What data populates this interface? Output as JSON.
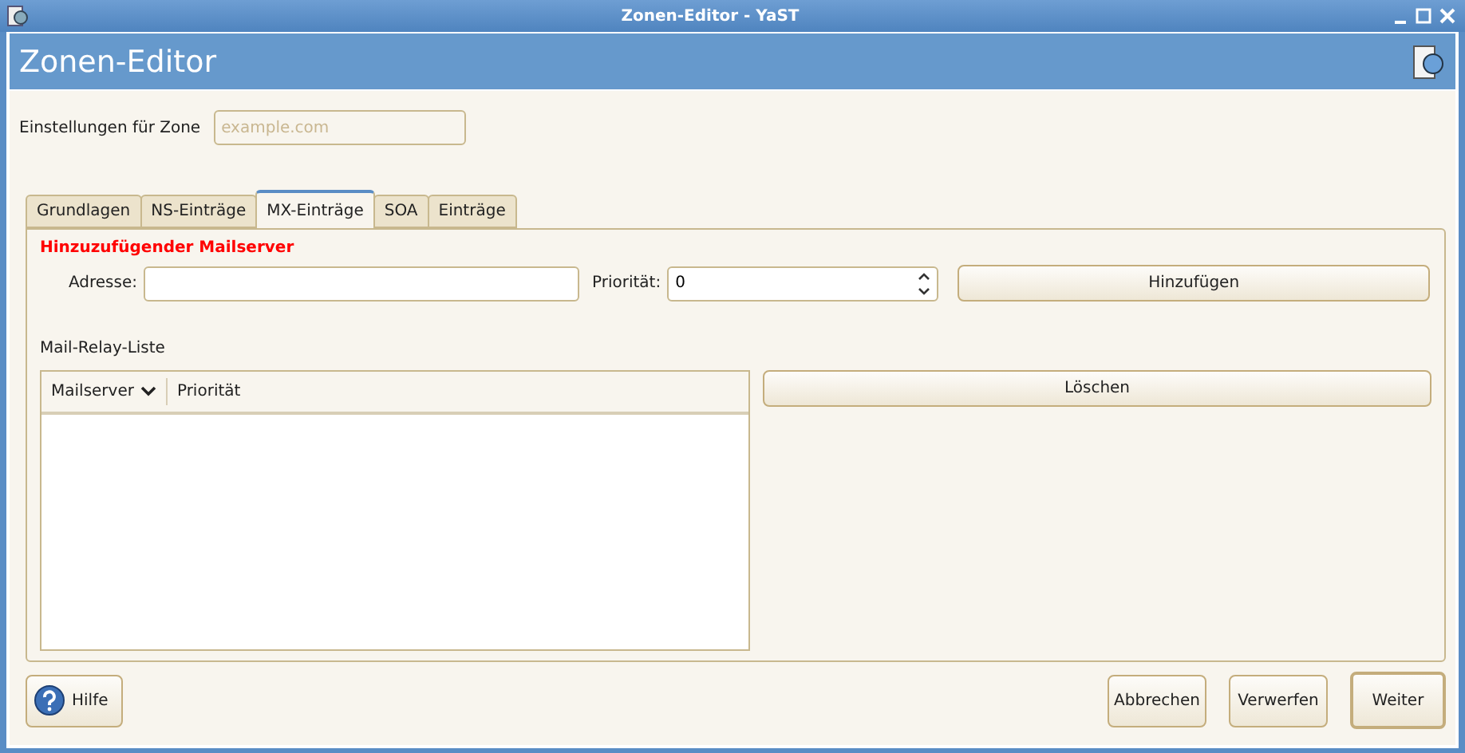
{
  "window": {
    "title": "Zonen-Editor - YaST"
  },
  "header": {
    "title": "Zonen-Editor"
  },
  "zone": {
    "label": "Einstellungen für Zone",
    "placeholder": "example.com"
  },
  "tabs": [
    {
      "label": "Grundlagen",
      "selected": false
    },
    {
      "label": "NS-Einträge",
      "selected": false
    },
    {
      "label": "MX-Einträge",
      "selected": true
    },
    {
      "label": "SOA",
      "selected": false
    },
    {
      "label": "Einträge",
      "selected": false
    }
  ],
  "section_title": "Hinzuzufügender Mailserver",
  "address": {
    "label": "Adresse:"
  },
  "priority": {
    "label": "Priorität:",
    "value": "0"
  },
  "add_button": "Hinzufügen",
  "list": {
    "label": "Mail-Relay-Liste",
    "columns": [
      "Mailserver",
      "Priorität"
    ]
  },
  "delete_button": "Löschen",
  "help_button": "Hilfe",
  "buttons": [
    {
      "label": "Abbrechen",
      "kind": "normal"
    },
    {
      "label": "Verwerfen",
      "kind": "normal"
    },
    {
      "label": "Weiter",
      "kind": "default"
    }
  ]
}
